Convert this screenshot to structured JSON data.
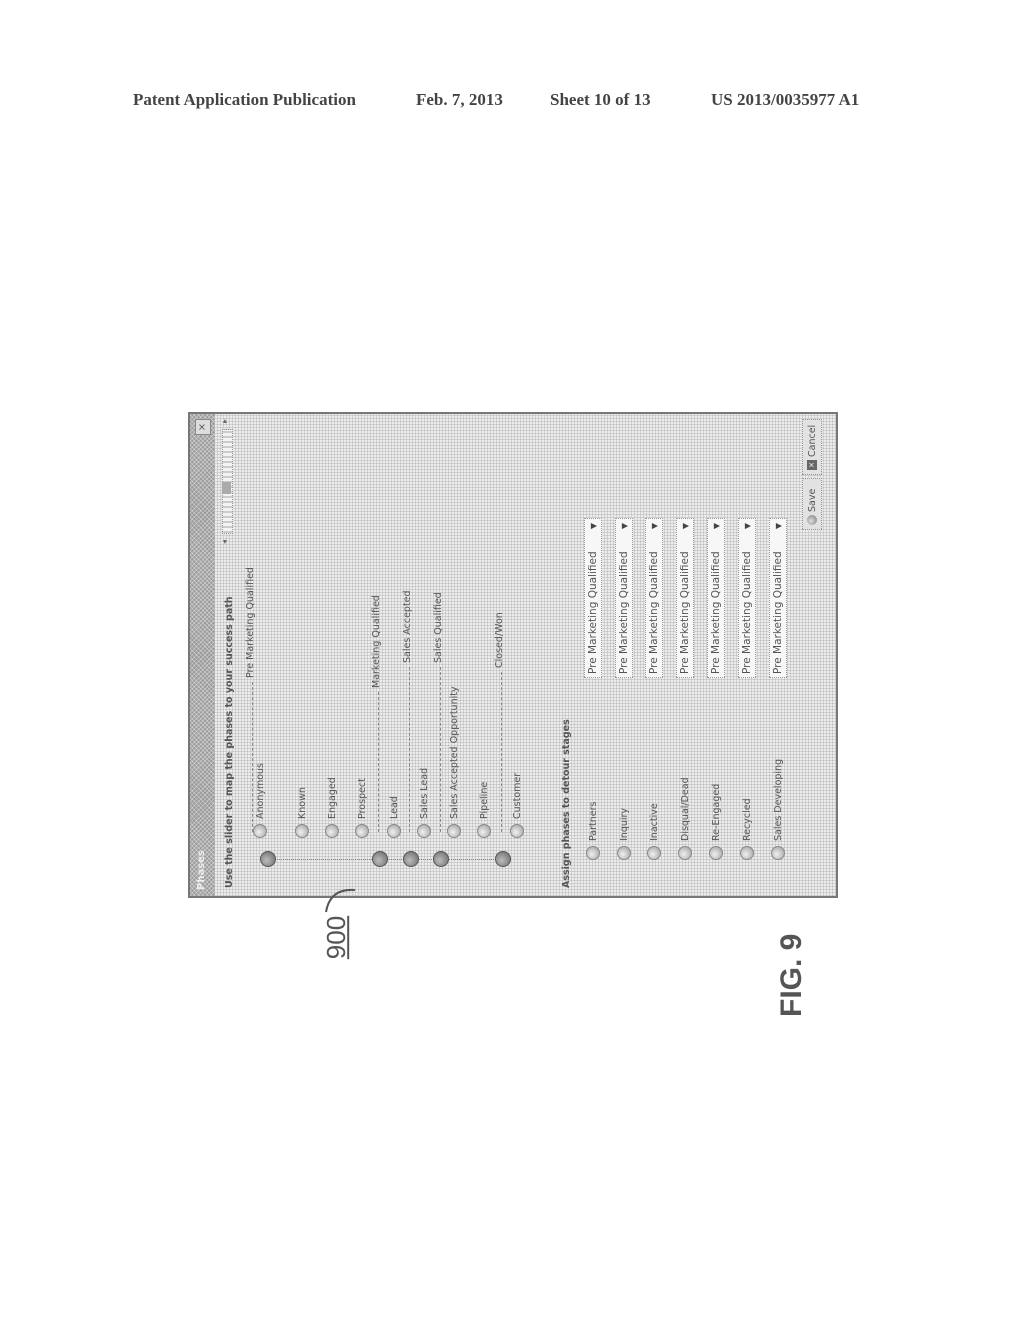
{
  "header": {
    "publication": "Patent Application Publication",
    "date": "Feb. 7, 2013",
    "sheet": "Sheet 10 of 13",
    "number": "US 2013/0035977 A1"
  },
  "dialog": {
    "title": "Phases",
    "close_icon": "×",
    "instruction": "Use the slider to map the phases to your success path",
    "stages": [
      {
        "label": "Anonymous"
      },
      {
        "label": "Known"
      },
      {
        "label": "Engaged"
      },
      {
        "label": "Prospect"
      },
      {
        "label": "Lead"
      },
      {
        "label": "Sales Lead"
      },
      {
        "label": "Sales Accepted Opportunity"
      },
      {
        "label": "Pipeline"
      },
      {
        "label": "Customer"
      }
    ],
    "phases": [
      {
        "label": "Pre Marketing Qualified"
      },
      {
        "label": "Marketing Qualified"
      },
      {
        "label": "Sales Accepted"
      },
      {
        "label": "Sales Qualified"
      },
      {
        "label": "Closed/Won"
      }
    ],
    "detour_heading": "Assign phases to detour stages",
    "detour_stages": [
      {
        "label": "Partners",
        "phase": "Pre Marketing Qualified"
      },
      {
        "label": "Inquiry",
        "phase": "Pre Marketing Qualified"
      },
      {
        "label": "Inactive",
        "phase": "Pre Marketing Qualified"
      },
      {
        "label": "Disqual/Dead",
        "phase": "Pre Marketing Qualified"
      },
      {
        "label": "Re-Engaged",
        "phase": "Pre Marketing Qualified"
      },
      {
        "label": "Recycled",
        "phase": "Pre Marketing Qualified"
      },
      {
        "label": "Sales Developing",
        "phase": "Pre Marketing Qualified"
      }
    ],
    "save_label": "Save",
    "cancel_label": "Cancel",
    "scroll_left": "◂",
    "scroll_right": "▸",
    "caret": "▼"
  },
  "reference_numeral": "900",
  "figure_label": "FIG. 9"
}
